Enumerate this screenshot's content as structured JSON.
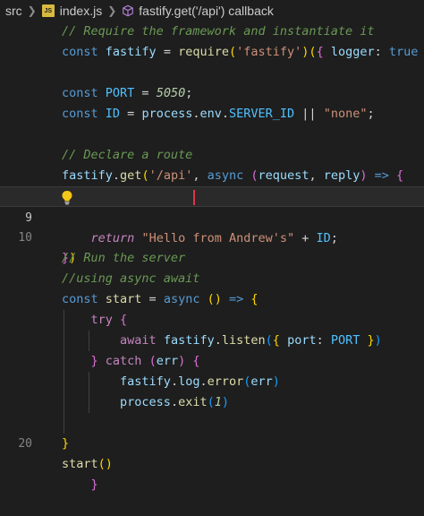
{
  "breadcrumb": {
    "folder": "src",
    "file": "index.js",
    "symbol": "fastify.get('/api') callback",
    "file_icon": "js-file-icon",
    "symbol_icon": "method-cube-icon"
  },
  "editor": {
    "line_numbers": {
      "n9": "9",
      "n10": "10",
      "n20": "20"
    },
    "lines": [
      [
        [
          "c",
          "// Require the framework and instantiate it"
        ]
      ],
      [
        [
          "kb",
          "const"
        ],
        [
          "p",
          " "
        ],
        [
          "v",
          "fastify"
        ],
        [
          "p",
          " = "
        ],
        [
          "f",
          "require"
        ],
        [
          "b",
          "("
        ],
        [
          "s",
          "'fastify'"
        ],
        [
          "b",
          ")"
        ],
        [
          "b",
          "("
        ],
        [
          "b2",
          "{"
        ],
        [
          "p",
          " "
        ],
        [
          "v",
          "logger"
        ],
        [
          "p",
          ": "
        ],
        [
          "kb",
          "true"
        ],
        [
          "p",
          " "
        ],
        [
          "b2",
          "}"
        ],
        [
          "b",
          ")"
        ]
      ],
      [],
      [
        [
          "kb",
          "const"
        ],
        [
          "p",
          " "
        ],
        [
          "cst",
          "PORT"
        ],
        [
          "p",
          " = "
        ],
        [
          "n",
          "5050"
        ],
        [
          "p",
          ";"
        ]
      ],
      [
        [
          "kb",
          "const"
        ],
        [
          "p",
          " "
        ],
        [
          "cst",
          "ID"
        ],
        [
          "p",
          " = "
        ],
        [
          "v",
          "process"
        ],
        [
          "p",
          "."
        ],
        [
          "v",
          "env"
        ],
        [
          "p",
          "."
        ],
        [
          "cst",
          "SERVER_ID"
        ],
        [
          "p",
          " || "
        ],
        [
          "s",
          "\"none\""
        ],
        [
          "p",
          ";"
        ]
      ],
      [],
      [
        [
          "c",
          "// Declare a route"
        ]
      ],
      [
        [
          "v",
          "fastify"
        ],
        [
          "p",
          "."
        ],
        [
          "f",
          "get"
        ],
        [
          "b",
          "("
        ],
        [
          "s",
          "'/api'"
        ],
        [
          "p",
          ", "
        ],
        [
          "kb",
          "async"
        ],
        [
          "p",
          " "
        ],
        [
          "b2",
          "("
        ],
        [
          "v",
          "request"
        ],
        [
          "p",
          ", "
        ],
        [
          "v",
          "reply"
        ],
        [
          "b2",
          ")"
        ],
        [
          "p",
          " "
        ],
        [
          "kb",
          "=>"
        ],
        [
          "p",
          " "
        ],
        [
          "b2",
          "{"
        ]
      ],
      [
        [
          "p",
          "    "
        ],
        [
          "kbi",
          "return"
        ],
        [
          "p",
          " "
        ],
        [
          "s",
          "\"Hello from Andrew's\""
        ],
        [
          "p",
          " + "
        ],
        [
          "cst",
          "ID"
        ],
        [
          "p",
          ";"
        ]
      ],
      [
        [
          "b2",
          "}"
        ],
        [
          "b",
          ")"
        ]
      ],
      [],
      [
        [
          "c",
          "// Run the server"
        ]
      ],
      [
        [
          "c",
          "//using async await"
        ]
      ],
      [
        [
          "kb",
          "const"
        ],
        [
          "p",
          " "
        ],
        [
          "f",
          "start"
        ],
        [
          "p",
          " = "
        ],
        [
          "kb",
          "async"
        ],
        [
          "p",
          " "
        ],
        [
          "b",
          "()"
        ],
        [
          "p",
          " "
        ],
        [
          "kb",
          "=>"
        ],
        [
          "p",
          " "
        ],
        [
          "b",
          "{"
        ]
      ],
      [
        [
          "p",
          "    "
        ],
        [
          "k",
          "try"
        ],
        [
          "p",
          " "
        ],
        [
          "b2",
          "{"
        ]
      ],
      [
        [
          "p",
          "        "
        ],
        [
          "k",
          "await"
        ],
        [
          "p",
          " "
        ],
        [
          "v",
          "fastify"
        ],
        [
          "p",
          "."
        ],
        [
          "f",
          "listen"
        ],
        [
          "b3",
          "("
        ],
        [
          "b",
          "{"
        ],
        [
          "p",
          " "
        ],
        [
          "v",
          "port"
        ],
        [
          "p",
          ": "
        ],
        [
          "cst",
          "PORT"
        ],
        [
          "p",
          " "
        ],
        [
          "b",
          "}"
        ],
        [
          "b3",
          ")"
        ]
      ],
      [
        [
          "p",
          "    "
        ],
        [
          "b2",
          "}"
        ],
        [
          "p",
          " "
        ],
        [
          "k",
          "catch"
        ],
        [
          "p",
          " "
        ],
        [
          "b2",
          "("
        ],
        [
          "v",
          "err"
        ],
        [
          "b2",
          ")"
        ],
        [
          "p",
          " "
        ],
        [
          "b2",
          "{"
        ]
      ],
      [
        [
          "p",
          "        "
        ],
        [
          "v",
          "fastify"
        ],
        [
          "p",
          "."
        ],
        [
          "v",
          "log"
        ],
        [
          "p",
          "."
        ],
        [
          "f",
          "error"
        ],
        [
          "b3",
          "("
        ],
        [
          "v",
          "err"
        ],
        [
          "b3",
          ")"
        ]
      ],
      [
        [
          "p",
          "        "
        ],
        [
          "v",
          "process"
        ],
        [
          "p",
          "."
        ],
        [
          "f",
          "exit"
        ],
        [
          "b3",
          "("
        ],
        [
          "n",
          "1"
        ],
        [
          "b3",
          ")"
        ]
      ],
      [
        [
          "p",
          "    "
        ],
        [
          "b2",
          "}"
        ]
      ],
      [
        [
          "b",
          "}"
        ]
      ],
      [
        [
          "f",
          "start"
        ],
        [
          "b",
          "()"
        ]
      ]
    ]
  },
  "colors": {
    "background": "#1e1e1e",
    "active_line": "#2a2a2a",
    "cursor": "#e0364a",
    "lightbulb": "#f5c518"
  }
}
